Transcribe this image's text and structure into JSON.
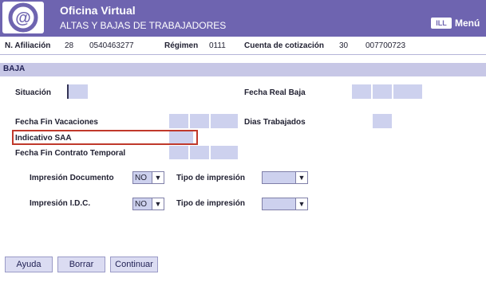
{
  "header": {
    "title": "Oficina Virtual",
    "subtitle": "ALTAS Y BAJAS DE TRABAJADORES",
    "menu_icon_text": "ILL",
    "menu_label": "Menú"
  },
  "infobar": {
    "afiliacion_label": "N. Afiliación",
    "afiliacion_prov": "28",
    "afiliacion_num": "0540463277",
    "regimen_label": "Régimen",
    "regimen_value": "0111",
    "cuenta_label": "Cuenta de cotización",
    "cuenta_prov": "30",
    "cuenta_num": "007700723"
  },
  "section": {
    "title": "BAJA"
  },
  "form": {
    "situacion_label": "Situación",
    "fecha_real_baja_label": "Fecha Real Baja",
    "fecha_fin_vacaciones_label": "Fecha Fin Vacaciones",
    "dias_trabajados_label": "Dias Trabajados",
    "indicativo_saa_label": "Indicativo SAA",
    "fecha_fin_contrato_label": "Fecha Fin Contrato Temporal",
    "impresion_documento_label": "Impresión Documento",
    "impresion_documento_value": "NO",
    "tipo_impresion_label_1": "Tipo de impresión",
    "tipo_impresion_value_1": "",
    "impresion_idc_label": "Impresión I.D.C.",
    "impresion_idc_value": "NO",
    "tipo_impresion_label_2": "Tipo de impresión",
    "tipo_impresion_value_2": ""
  },
  "buttons": {
    "ayuda": "Ayuda",
    "borrar": "Borrar",
    "continuar": "Continuar"
  },
  "colors": {
    "header_bg": "#6e64b0",
    "section_bg": "#c7c7e6",
    "field_bg": "#cdd1ee",
    "highlight_border": "#c0392b"
  }
}
